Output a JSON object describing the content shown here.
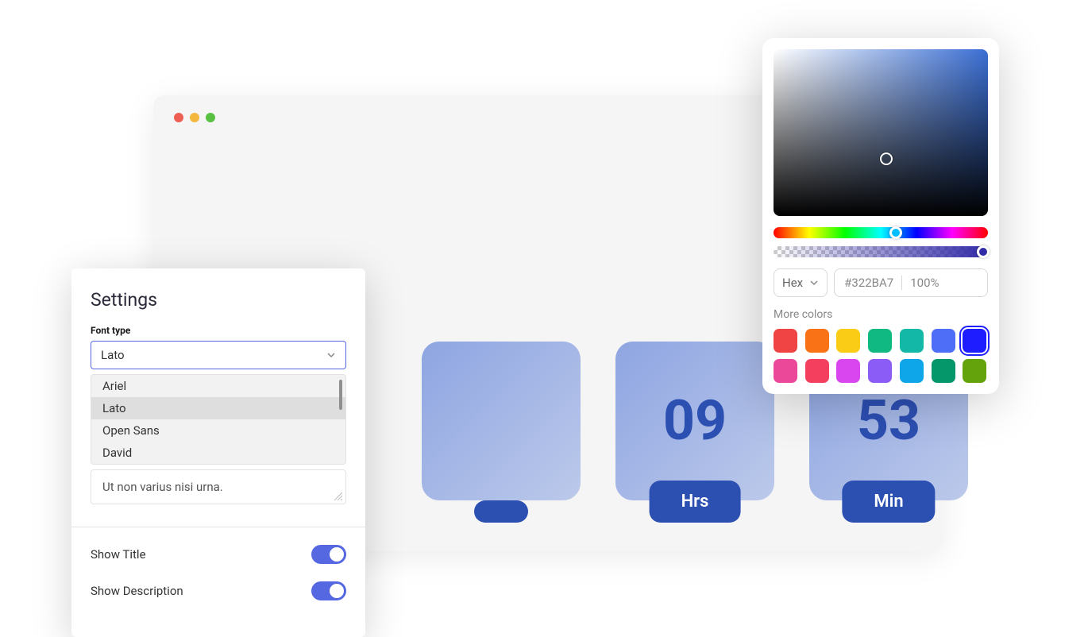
{
  "countdown": {
    "tiles": [
      {
        "value": "",
        "label": ""
      },
      {
        "value": "09",
        "label": "Hrs"
      },
      {
        "value": "53",
        "label": "Min"
      }
    ]
  },
  "settings": {
    "title": "Settings",
    "font_label": "Font type",
    "font_selected": "Lato",
    "font_options": [
      "Ariel",
      "Lato",
      "Open Sans",
      "David"
    ],
    "textarea_value": "Ut non varius nisi urna.",
    "show_title_label": "Show Title",
    "show_description_label": "Show Description"
  },
  "colorpicker": {
    "format": "Hex",
    "hex": "#322BA7",
    "opacity": "100%",
    "more_colors_label": "More colors",
    "swatches": [
      "#f04343",
      "#f97316",
      "#facc15",
      "#10b981",
      "#14b8a6",
      "#4f6ef7",
      "#1d1dff",
      "#ec4899",
      "#f43f5e",
      "#d946ef",
      "#8b5cf6",
      "#0ea5e9",
      "#059669",
      "#65a30d"
    ],
    "selected_swatch_index": 6
  }
}
